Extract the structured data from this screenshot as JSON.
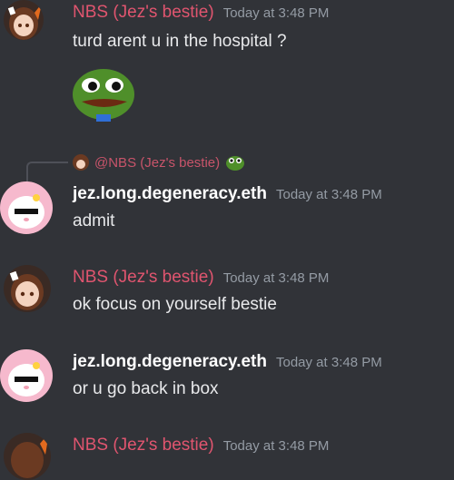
{
  "messages": [
    {
      "author": "NBS (Jez's bestie)",
      "timestamp": "Today at 3:48 PM",
      "text": "turd arent u in the hospital ?"
    },
    {
      "author": "jez.long.degeneracy.eth",
      "timestamp": "Today at 3:48 PM",
      "text": "admit",
      "reply_to": "@NBS (Jez's bestie)"
    },
    {
      "author": "NBS (Jez's bestie)",
      "timestamp": "Today at 3:48 PM",
      "text": "ok focus on yourself bestie"
    },
    {
      "author": "jez.long.degeneracy.eth",
      "timestamp": "Today at 3:48 PM",
      "text": "or u go back in box"
    },
    {
      "author": "NBS (Jez's bestie)",
      "timestamp": "Today at 3:48 PM",
      "text": ""
    }
  ],
  "colors": {
    "background": "#313338",
    "nbs_name": "#e0556f",
    "jez_name": "#ffffff",
    "timestamp": "#949ba4"
  },
  "icons": {
    "nbs_avatar": "anime-girl-avatar",
    "jez_avatar": "my-melody-avatar",
    "emoji": "pepe-emoji"
  }
}
